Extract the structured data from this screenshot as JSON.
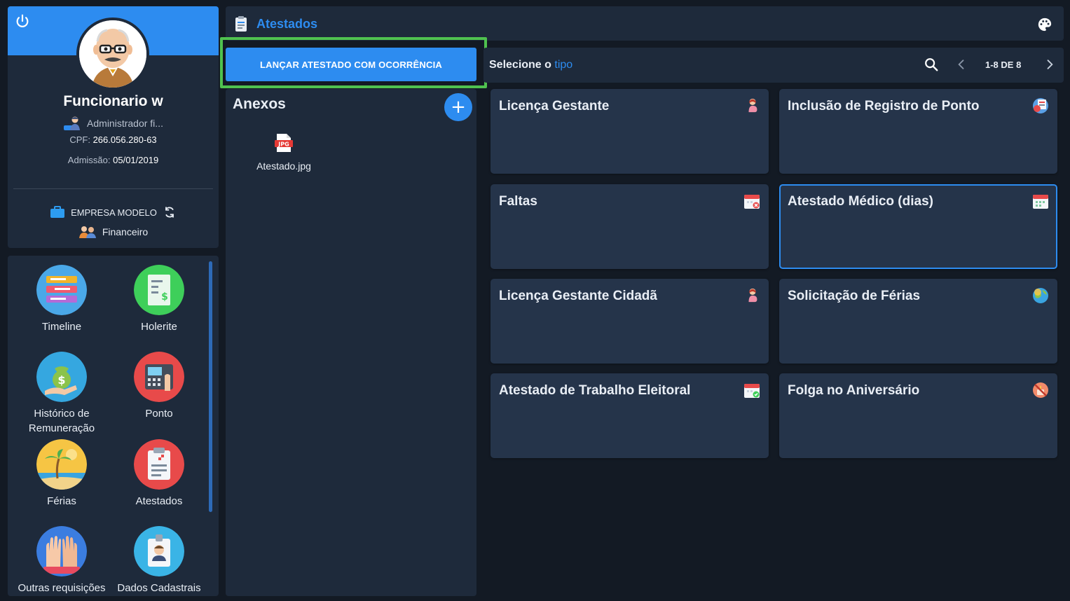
{
  "profile": {
    "name": "Funcionario w",
    "role": "Administrador fi...",
    "cpf_label": "CPF:",
    "cpf_value": "266.056.280-63",
    "admission_label": "Admissão:",
    "admission_value": "05/01/2019",
    "company": "EMPRESA MODELO",
    "department": "Financeiro"
  },
  "menu": {
    "items": [
      {
        "label": "Timeline",
        "icon": "timeline-icon"
      },
      {
        "label": "Holerite",
        "icon": "payslip-icon"
      },
      {
        "label": "Histórico de Remuneração",
        "icon": "money-bag-icon"
      },
      {
        "label": "Ponto",
        "icon": "time-clock-icon"
      },
      {
        "label": "Férias",
        "icon": "beach-icon"
      },
      {
        "label": "Atestados",
        "icon": "clipboard-icon"
      },
      {
        "label": "Outras requisições",
        "icon": "raised-hands-icon"
      },
      {
        "label": "Dados Cadastrais",
        "icon": "id-badge-icon"
      }
    ]
  },
  "topbar": {
    "title": "Atestados"
  },
  "launch_button": {
    "label": "LANÇAR ATESTADO COM OCORRÊNCIA"
  },
  "anexos": {
    "title": "Anexos",
    "add_label": "+",
    "files": [
      {
        "name": "Atestado.jpg",
        "badge": "JPG"
      }
    ]
  },
  "type_toolbar": {
    "label_prefix": "Selecione o",
    "label_accent": "tipo",
    "page_count": "1-8 DE 8"
  },
  "types": [
    {
      "title": "Licença Gestante",
      "icon": "pregnant-woman-icon"
    },
    {
      "title": "Inclusão de Registro de Ponto",
      "icon": "clock-register-icon"
    },
    {
      "title": "Faltas",
      "icon": "calendar-absence-icon"
    },
    {
      "title": "Atestado Médico (dias)",
      "icon": "calendar-medical-icon",
      "selected": true
    },
    {
      "title": "Licença Gestante Cidadã",
      "icon": "pregnant-woman-icon"
    },
    {
      "title": "Solicitação de Férias",
      "icon": "globe-vacation-icon"
    },
    {
      "title": "Atestado de Trabalho Eleitoral",
      "icon": "calendar-vote-icon"
    },
    {
      "title": "Folga no Aniversário",
      "icon": "birthday-off-icon"
    }
  ],
  "colors": {
    "accent": "#2d8cf0",
    "highlight": "#4fc24f",
    "background": "#131a24",
    "panel": "#1e2a3b",
    "card": "#25344a"
  }
}
